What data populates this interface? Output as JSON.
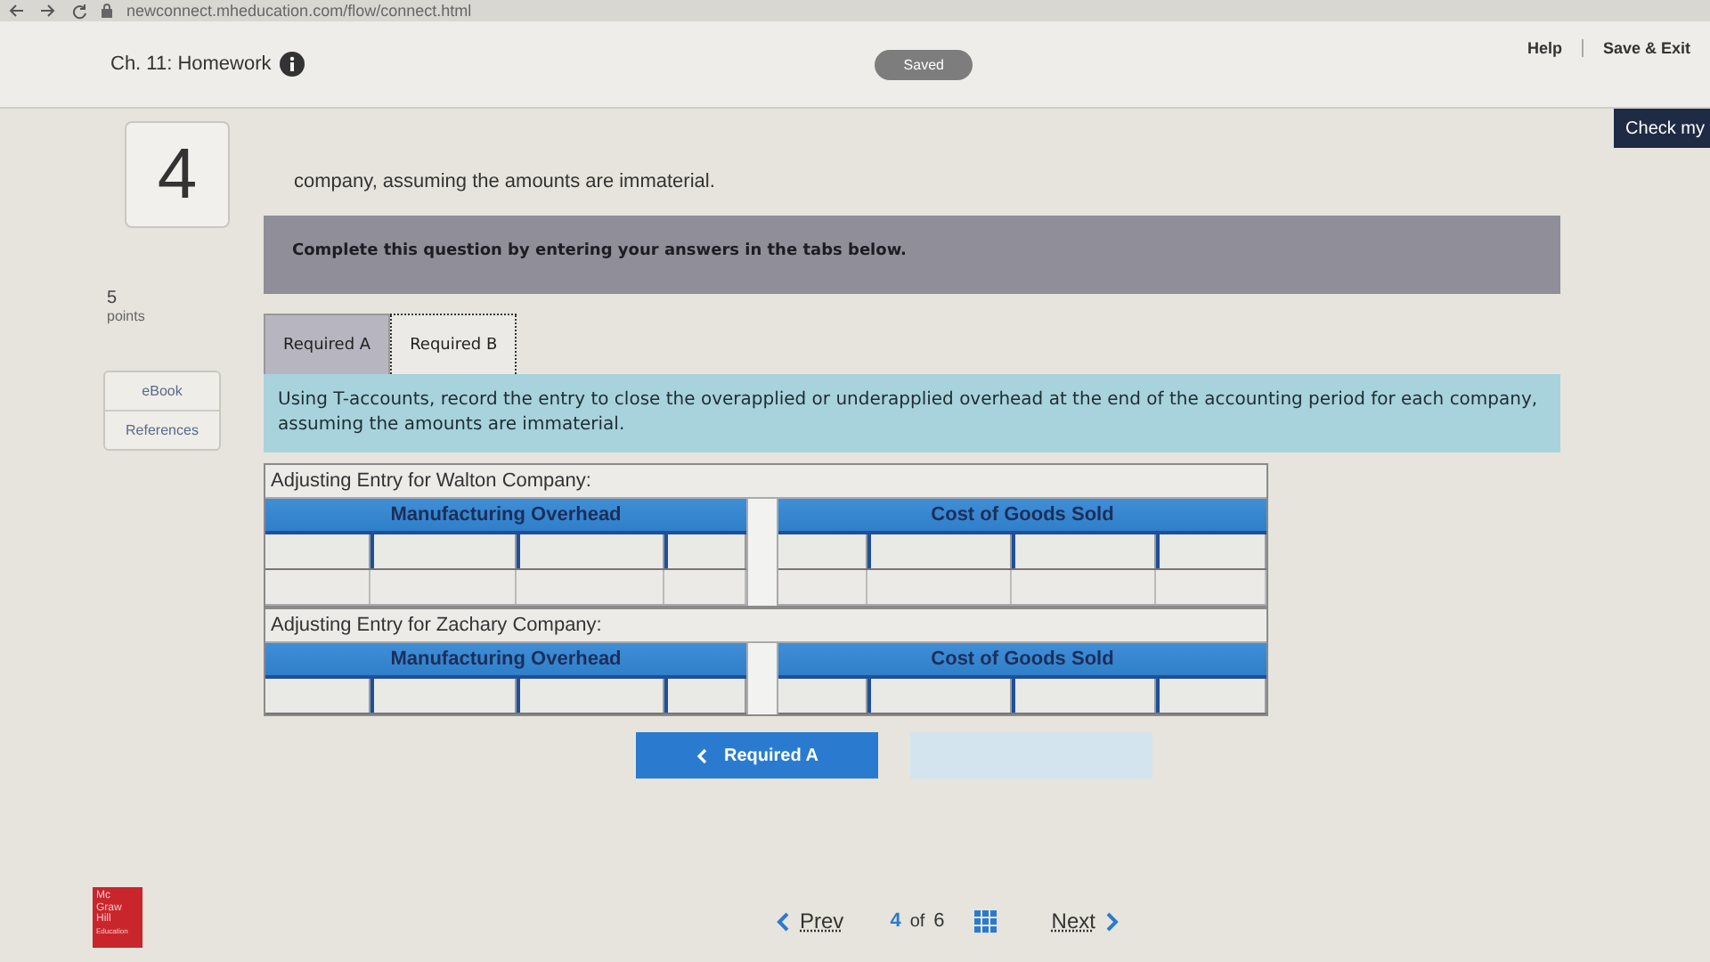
{
  "browser": {
    "url": "newconnect.mheducation.com/flow/connect.html"
  },
  "header": {
    "title": "Ch. 11: Homework",
    "status": "Saved",
    "links": [
      "Help",
      "Save & Exit"
    ]
  },
  "check_button": "Check my",
  "question": {
    "number": "4",
    "points": "5",
    "points_label": "points",
    "resources": [
      "eBook",
      "References"
    ],
    "text_tail": "company, assuming the amounts are immaterial."
  },
  "instruction": "Complete this question by entering your answers in the tabs below.",
  "tabs": [
    {
      "label": "Required A",
      "selected": false
    },
    {
      "label": "Required B",
      "selected": true
    }
  ],
  "prompt": "Using T-accounts, record the entry to close the overapplied or underapplied overhead at the end of the accounting period for each company, assuming the amounts are immaterial.",
  "entries": [
    {
      "title": "Adjusting Entry for Walton Company:",
      "accounts": [
        "Manufacturing Overhead",
        "Cost of Goods Sold"
      ],
      "rows": [
        {
          "kind": "input"
        },
        {
          "kind": "blank"
        }
      ]
    },
    {
      "title": "Adjusting Entry for Zachary Company:",
      "accounts": [
        "Manufacturing Overhead",
        "Cost of Goods Sold"
      ],
      "rows": [
        {
          "kind": "input"
        }
      ]
    }
  ],
  "nav_buttons": [
    {
      "label": "Required A",
      "disabled": false
    },
    {
      "disabled": true
    }
  ],
  "logo": [
    "Mc",
    "Graw",
    "Hill",
    "Education"
  ],
  "footer": {
    "prev": "Prev",
    "current": "4",
    "of": "of",
    "total": "6",
    "next": "Next"
  }
}
